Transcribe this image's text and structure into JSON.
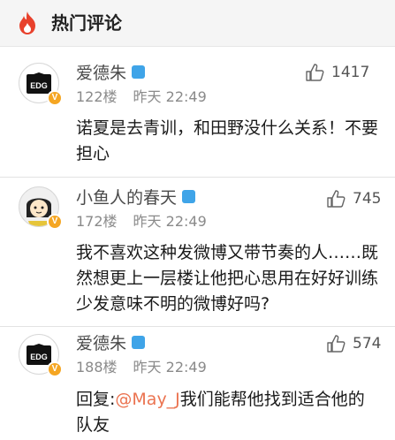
{
  "header": {
    "title": "热门评论",
    "icon": "flame-icon",
    "accent": "#e8412c"
  },
  "comments": [
    {
      "username": "爱德朱",
      "floor": "122楼",
      "time": "昨天 22:49",
      "likes": "1417",
      "text": "诺夏是去青训，和田野没什么关系！不要担心",
      "avatar": "edg-logo-avatar",
      "verified": "V"
    },
    {
      "username": "小鱼人的春天",
      "floor": "172楼",
      "time": "昨天 22:49",
      "likes": "745",
      "text": "我不喜欢这种发微博又带节奏的人……既然想更上一层楼让他把心思用在好好训练少发意味不明的微博好吗?",
      "avatar": "cartoon-character-avatar",
      "verified": "V"
    },
    {
      "username": "爱德朱",
      "floor": "188楼",
      "time": "昨天 22:49",
      "likes": "574",
      "reply_prefix": "回复:",
      "mention": "@May_J",
      "text": "我们能帮他找到适合他的队友",
      "avatar": "edg-logo-avatar",
      "verified": "V"
    }
  ],
  "colors": {
    "gender_badge": "#3fa4e8",
    "vip_badge": "#f5a623",
    "mention": "#eb7350"
  }
}
